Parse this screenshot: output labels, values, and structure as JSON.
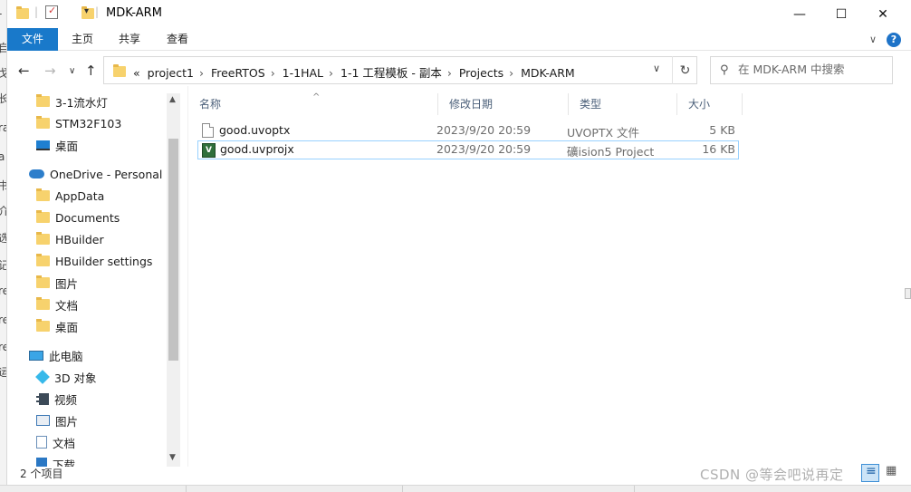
{
  "window": {
    "title": "MDK-ARM",
    "minimize_glyph": "—",
    "maximize_glyph": "☐",
    "close_glyph": "✕"
  },
  "ribbon": {
    "tabs": [
      {
        "label": "文件"
      },
      {
        "label": "主页"
      },
      {
        "label": "共享"
      },
      {
        "label": "查看"
      }
    ],
    "expand_glyph": "∨",
    "help_glyph": "?"
  },
  "navigation": {
    "back": "←",
    "forward": "→",
    "recent": "∨",
    "up": "↑",
    "refresh": "↻",
    "dropdown": "∨"
  },
  "address": {
    "overflow": "«",
    "crumbs": [
      "project1",
      "FreeRTOS",
      "1-1HAL",
      "1-1 工程模板 - 副本",
      "Projects",
      "MDK-ARM"
    ],
    "separator": "›"
  },
  "search": {
    "placeholder": "在 MDK-ARM 中搜索",
    "icon": "search-icon"
  },
  "nav_pane": {
    "items": [
      {
        "label": "3-1流水灯",
        "icon": "folder-icon"
      },
      {
        "label": "STM32F103",
        "icon": "folder-icon"
      },
      {
        "label": "桌面",
        "icon": "desktop-icon"
      },
      {
        "label": "OneDrive - Personal",
        "icon": "onedrive-cloud-icon"
      },
      {
        "label": "AppData",
        "icon": "folder-icon"
      },
      {
        "label": "Documents",
        "icon": "folder-icon"
      },
      {
        "label": "HBuilder",
        "icon": "folder-icon"
      },
      {
        "label": "HBuilder settings",
        "icon": "folder-icon"
      },
      {
        "label": "图片",
        "icon": "folder-icon"
      },
      {
        "label": "文档",
        "icon": "folder-icon"
      },
      {
        "label": "桌面",
        "icon": "folder-icon"
      },
      {
        "label": "此电脑",
        "icon": "this-pc-icon"
      },
      {
        "label": "3D 对象",
        "icon": "3d-objects-icon"
      },
      {
        "label": "视频",
        "icon": "videos-icon"
      },
      {
        "label": "图片",
        "icon": "pictures-icon"
      },
      {
        "label": "文档",
        "icon": "documents-icon"
      },
      {
        "label": "下载",
        "icon": "downloads-icon"
      }
    ]
  },
  "columns": [
    {
      "label": "名称"
    },
    {
      "label": "修改日期"
    },
    {
      "label": "类型"
    },
    {
      "label": "大小"
    }
  ],
  "files": [
    {
      "name": "good.uvoptx",
      "date": "2023/9/20 20:59",
      "type": "UVOPTX 文件",
      "size": "5 KB",
      "icon": "generic-file-icon",
      "selected": false
    },
    {
      "name": "good.uvprojx",
      "date": "2023/9/20 20:59",
      "type": "礦ision5 Project",
      "size": "16 KB",
      "icon": "uvision-project-icon",
      "selected": true
    }
  ],
  "status": {
    "count": "2 个项目"
  },
  "watermark": "CSDN @等会吧说再定",
  "colors": {
    "accent": "#1979ca",
    "selection_border": "#99d1ff",
    "folder": "#f7d26d"
  }
}
